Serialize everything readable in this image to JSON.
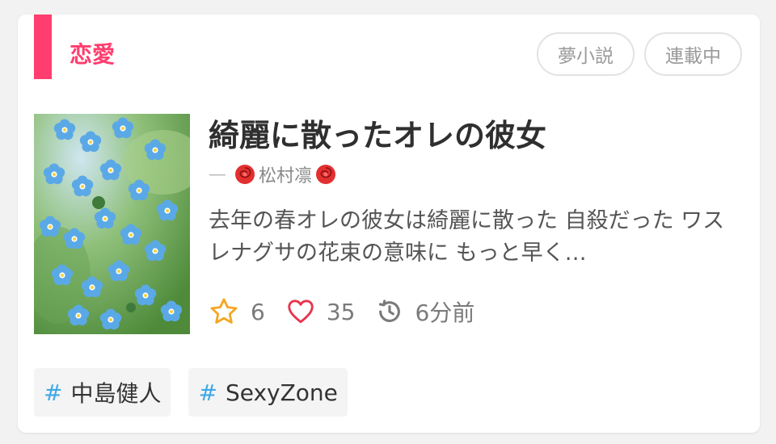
{
  "genre": {
    "label": "恋愛",
    "color": "#ff3d6e"
  },
  "badges": [
    "夢小説",
    "連載中"
  ],
  "story": {
    "title": "綺麗に散ったオレの彼女",
    "author": {
      "dash": "—",
      "name": "松村凛",
      "decoration_icon": "rose-icon"
    },
    "description": "去年の春オレの彼女は綺麗に散った 自殺だった ワスレナグサの花束の意味に もっと早く…",
    "stats": {
      "stars": "6",
      "likes": "35",
      "updated": "6分前"
    }
  },
  "tags": [
    {
      "hash": "#",
      "label": "中島健人"
    },
    {
      "hash": "#",
      "label": "SexyZone"
    }
  ],
  "colors": {
    "accent": "#ff3d6e",
    "star": "#f5a623",
    "heart": "#e8344e",
    "tag_hash": "#3fa9e6"
  }
}
